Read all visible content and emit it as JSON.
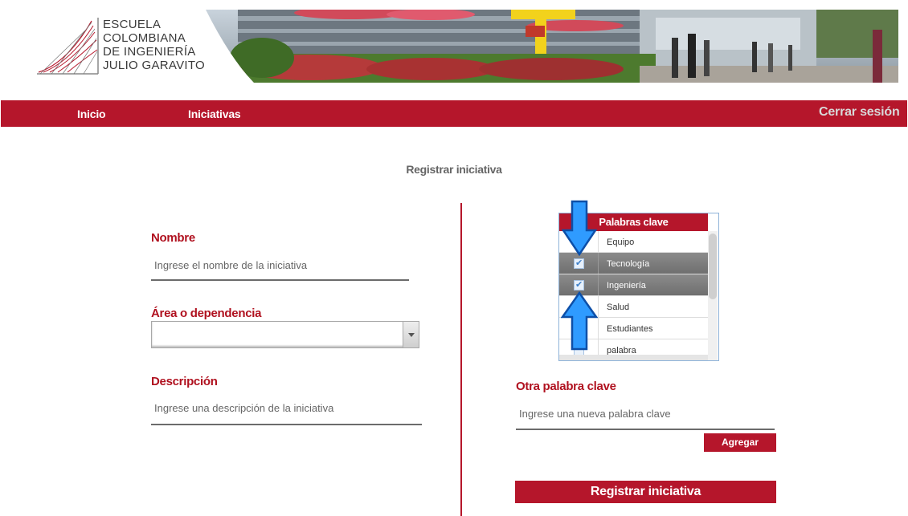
{
  "header": {
    "logo_lines": [
      "ESCUELA",
      "COLOMBIANA",
      "DE INGENIERÍA",
      "JULIO GARAVITO"
    ]
  },
  "nav": {
    "items": [
      {
        "label": "Inicio"
      },
      {
        "label": "Iniciativas"
      }
    ],
    "logout_label": "Cerrar sesión"
  },
  "page": {
    "title": "Registrar iniciativa"
  },
  "form": {
    "nombre": {
      "label": "Nombre",
      "placeholder": "Ingrese el nombre de la iniciativa",
      "value": ""
    },
    "area": {
      "label": "Área o dependencia",
      "selected": ""
    },
    "descripcion": {
      "label": "Descripción",
      "placeholder": "Ingrese una descripción de la iniciativa",
      "value": ""
    }
  },
  "keywords": {
    "header": "Palabras clave",
    "items": [
      {
        "label": "Equipo",
        "checked": false
      },
      {
        "label": "Tecnología",
        "checked": true
      },
      {
        "label": "Ingeniería",
        "checked": true
      },
      {
        "label": "Salud",
        "checked": false
      },
      {
        "label": "Estudiantes",
        "checked": false
      },
      {
        "label": "palabra",
        "checked": false
      }
    ],
    "other_label": "Otra palabra clave",
    "other_placeholder": "Ingrese una nueva palabra clave",
    "add_button": "Agregar"
  },
  "submit_button": "Registrar iniciativa",
  "colors": {
    "brand_red": "#b5162b",
    "label_red": "#b0111f",
    "annotation_arrow": "#1e90ff"
  }
}
